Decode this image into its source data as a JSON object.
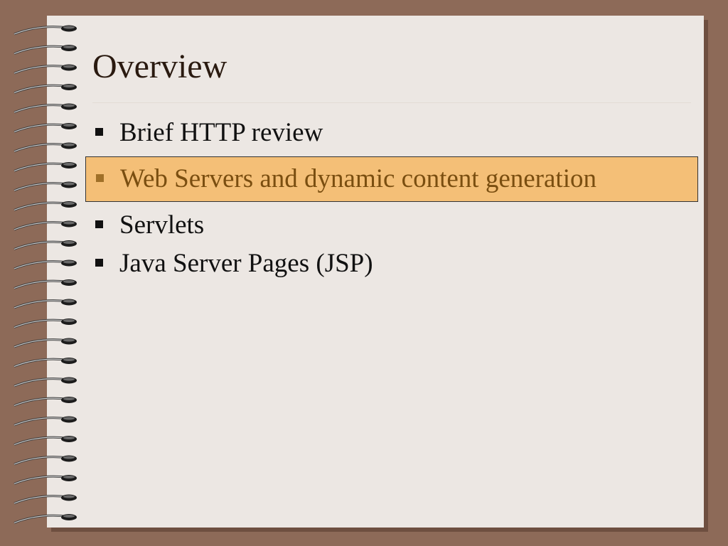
{
  "slide": {
    "title": "Overview",
    "bullets": [
      {
        "text": "Brief HTTP review",
        "highlighted": false
      },
      {
        "text": "Web Servers and dynamic content generation",
        "highlighted": true
      },
      {
        "text": "Servlets",
        "highlighted": false
      },
      {
        "text": "Java Server Pages (JSP)",
        "highlighted": false
      }
    ]
  },
  "colors": {
    "background": "#8d6a58",
    "paper": "#ece7e3",
    "highlight_fill": "#f4bf77",
    "highlight_text": "#7a4e10",
    "text": "#111111"
  },
  "icons": {
    "binding": "spiral-binding-icon",
    "bullet": "square-bullet-icon"
  }
}
